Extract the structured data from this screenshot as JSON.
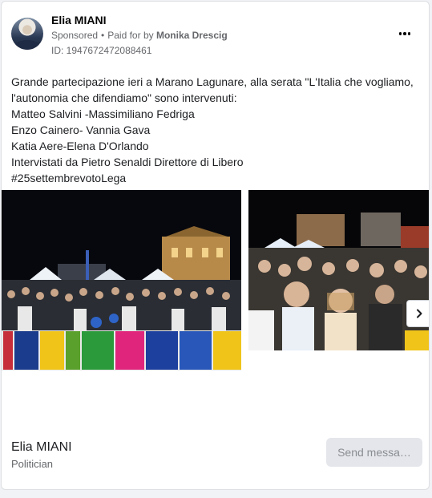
{
  "post": {
    "author": "Elia MIANI",
    "sponsored_label": "Sponsored",
    "paid_for_prefix": "Paid for by",
    "paid_for_name": "Monika Drescig",
    "id_label": "ID: 1947672472088461",
    "more_icon": "more-horizontal-icon",
    "text_lines": [
      "Grande partecipazione ieri a Marano Lagunare, alla serata \"L'Italia che vogliamo,",
      "l'autonomia che difendiamo\" sono intervenuti:",
      "Matteo Salvini -Massimiliano Fedriga",
      "Enzo Cainero- Vannia Gava",
      "Katia Aere-Elena D'Orlando",
      "Intervistati da Pietro Senaldi Direttore di Libero",
      "#25settembrevotoLega"
    ]
  },
  "carousel": {
    "next_icon": "chevron-right-icon",
    "slides": [
      {
        "name": "carousel-image-crowd-square"
      },
      {
        "name": "carousel-image-crowd-closeup"
      }
    ]
  },
  "footer": {
    "page_name": "Elia MIANI",
    "page_category": "Politician",
    "send_button_label": "Send messa…"
  },
  "colors": {
    "background": "#f0f2f5",
    "card": "#ffffff",
    "muted_text": "#65676b",
    "button_bg": "#e4e6eb"
  }
}
